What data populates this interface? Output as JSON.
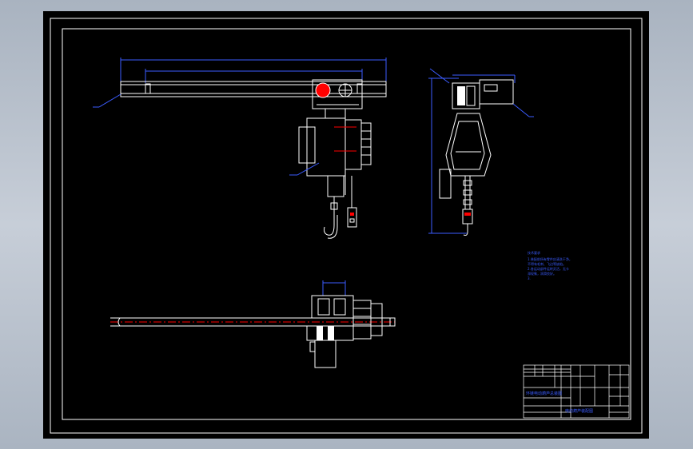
{
  "colors": {
    "background": "#000000",
    "frame": "#ffffff",
    "dimension": "#3b5cff",
    "accent": "#ff0000",
    "desktop": "#b9c1cc"
  },
  "tech_notes": {
    "heading": "技术要求",
    "lines": [
      "1.装配前所有零件应清洗干净，",
      "不得有毛刺、飞边等缺陷。",
      "2.各运动部件运转灵活，无卡",
      "滞现象，润滑良好。",
      "3."
    ]
  },
  "title_block": {
    "drawing_name": "环链电动葫芦总装图",
    "drawing_name_lower": "电动葫芦装配图"
  }
}
